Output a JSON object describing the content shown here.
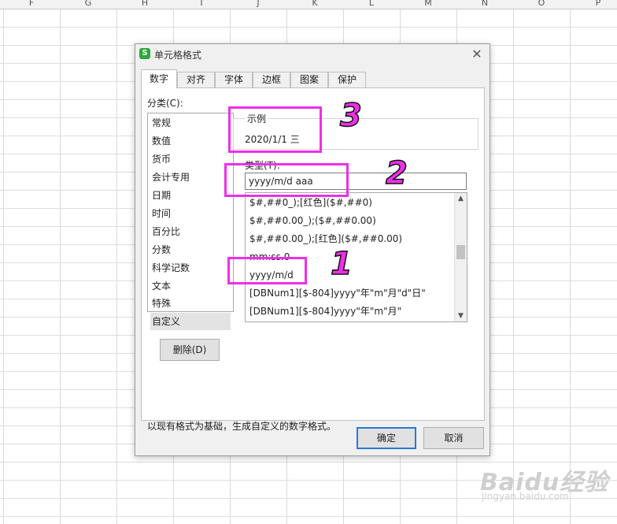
{
  "sheet": {
    "columns": [
      "F",
      "G",
      "H",
      "I",
      "J",
      "K",
      "L",
      "M",
      "N",
      "O",
      "P"
    ]
  },
  "dialog": {
    "title": "单元格格式",
    "app_icon": "S",
    "close_glyph": "✕",
    "tabs": [
      "数字",
      "对齐",
      "字体",
      "边框",
      "图案",
      "保护"
    ],
    "category_label": "分类(C):",
    "categories": [
      "常规",
      "数值",
      "货币",
      "会计专用",
      "日期",
      "时间",
      "百分比",
      "分数",
      "科学记数",
      "文本",
      "特殊",
      "自定义"
    ],
    "selected_category": "自定义",
    "sample": {
      "legend": "示例",
      "value": "2020/1/1 三"
    },
    "type_label": "类型(T):",
    "type_value": "yyyy/m/d aaa",
    "formats": [
      "$#,##0_);[红色]($#,##0)",
      "$#,##0.00_);($#,##0.00)",
      "$#,##0.00_);[红色]($#,##0.00)",
      "mm:ss.0",
      "yyyy/m/d",
      "[DBNum1][$-804]yyyy\"年\"m\"月\"d\"日\"",
      "[DBNum1][$-804]yyyy\"年\"m\"月\""
    ],
    "delete_button": "删除(D)",
    "description": "以现有格式为基础，生成自定义的数字格式。",
    "ok_button": "确定",
    "cancel_button": "取消"
  },
  "annotations": {
    "one": "1",
    "two": "2",
    "three": "3",
    "color": "#ee2fe8"
  },
  "watermark": {
    "main": "Baidu经验",
    "sub": "jingyan.baidu.com"
  },
  "icons": {
    "app": "wps-spreadsheet-icon",
    "close": "close-icon",
    "scroll_up": "chevron-up-icon",
    "scroll_down": "chevron-down-icon"
  }
}
